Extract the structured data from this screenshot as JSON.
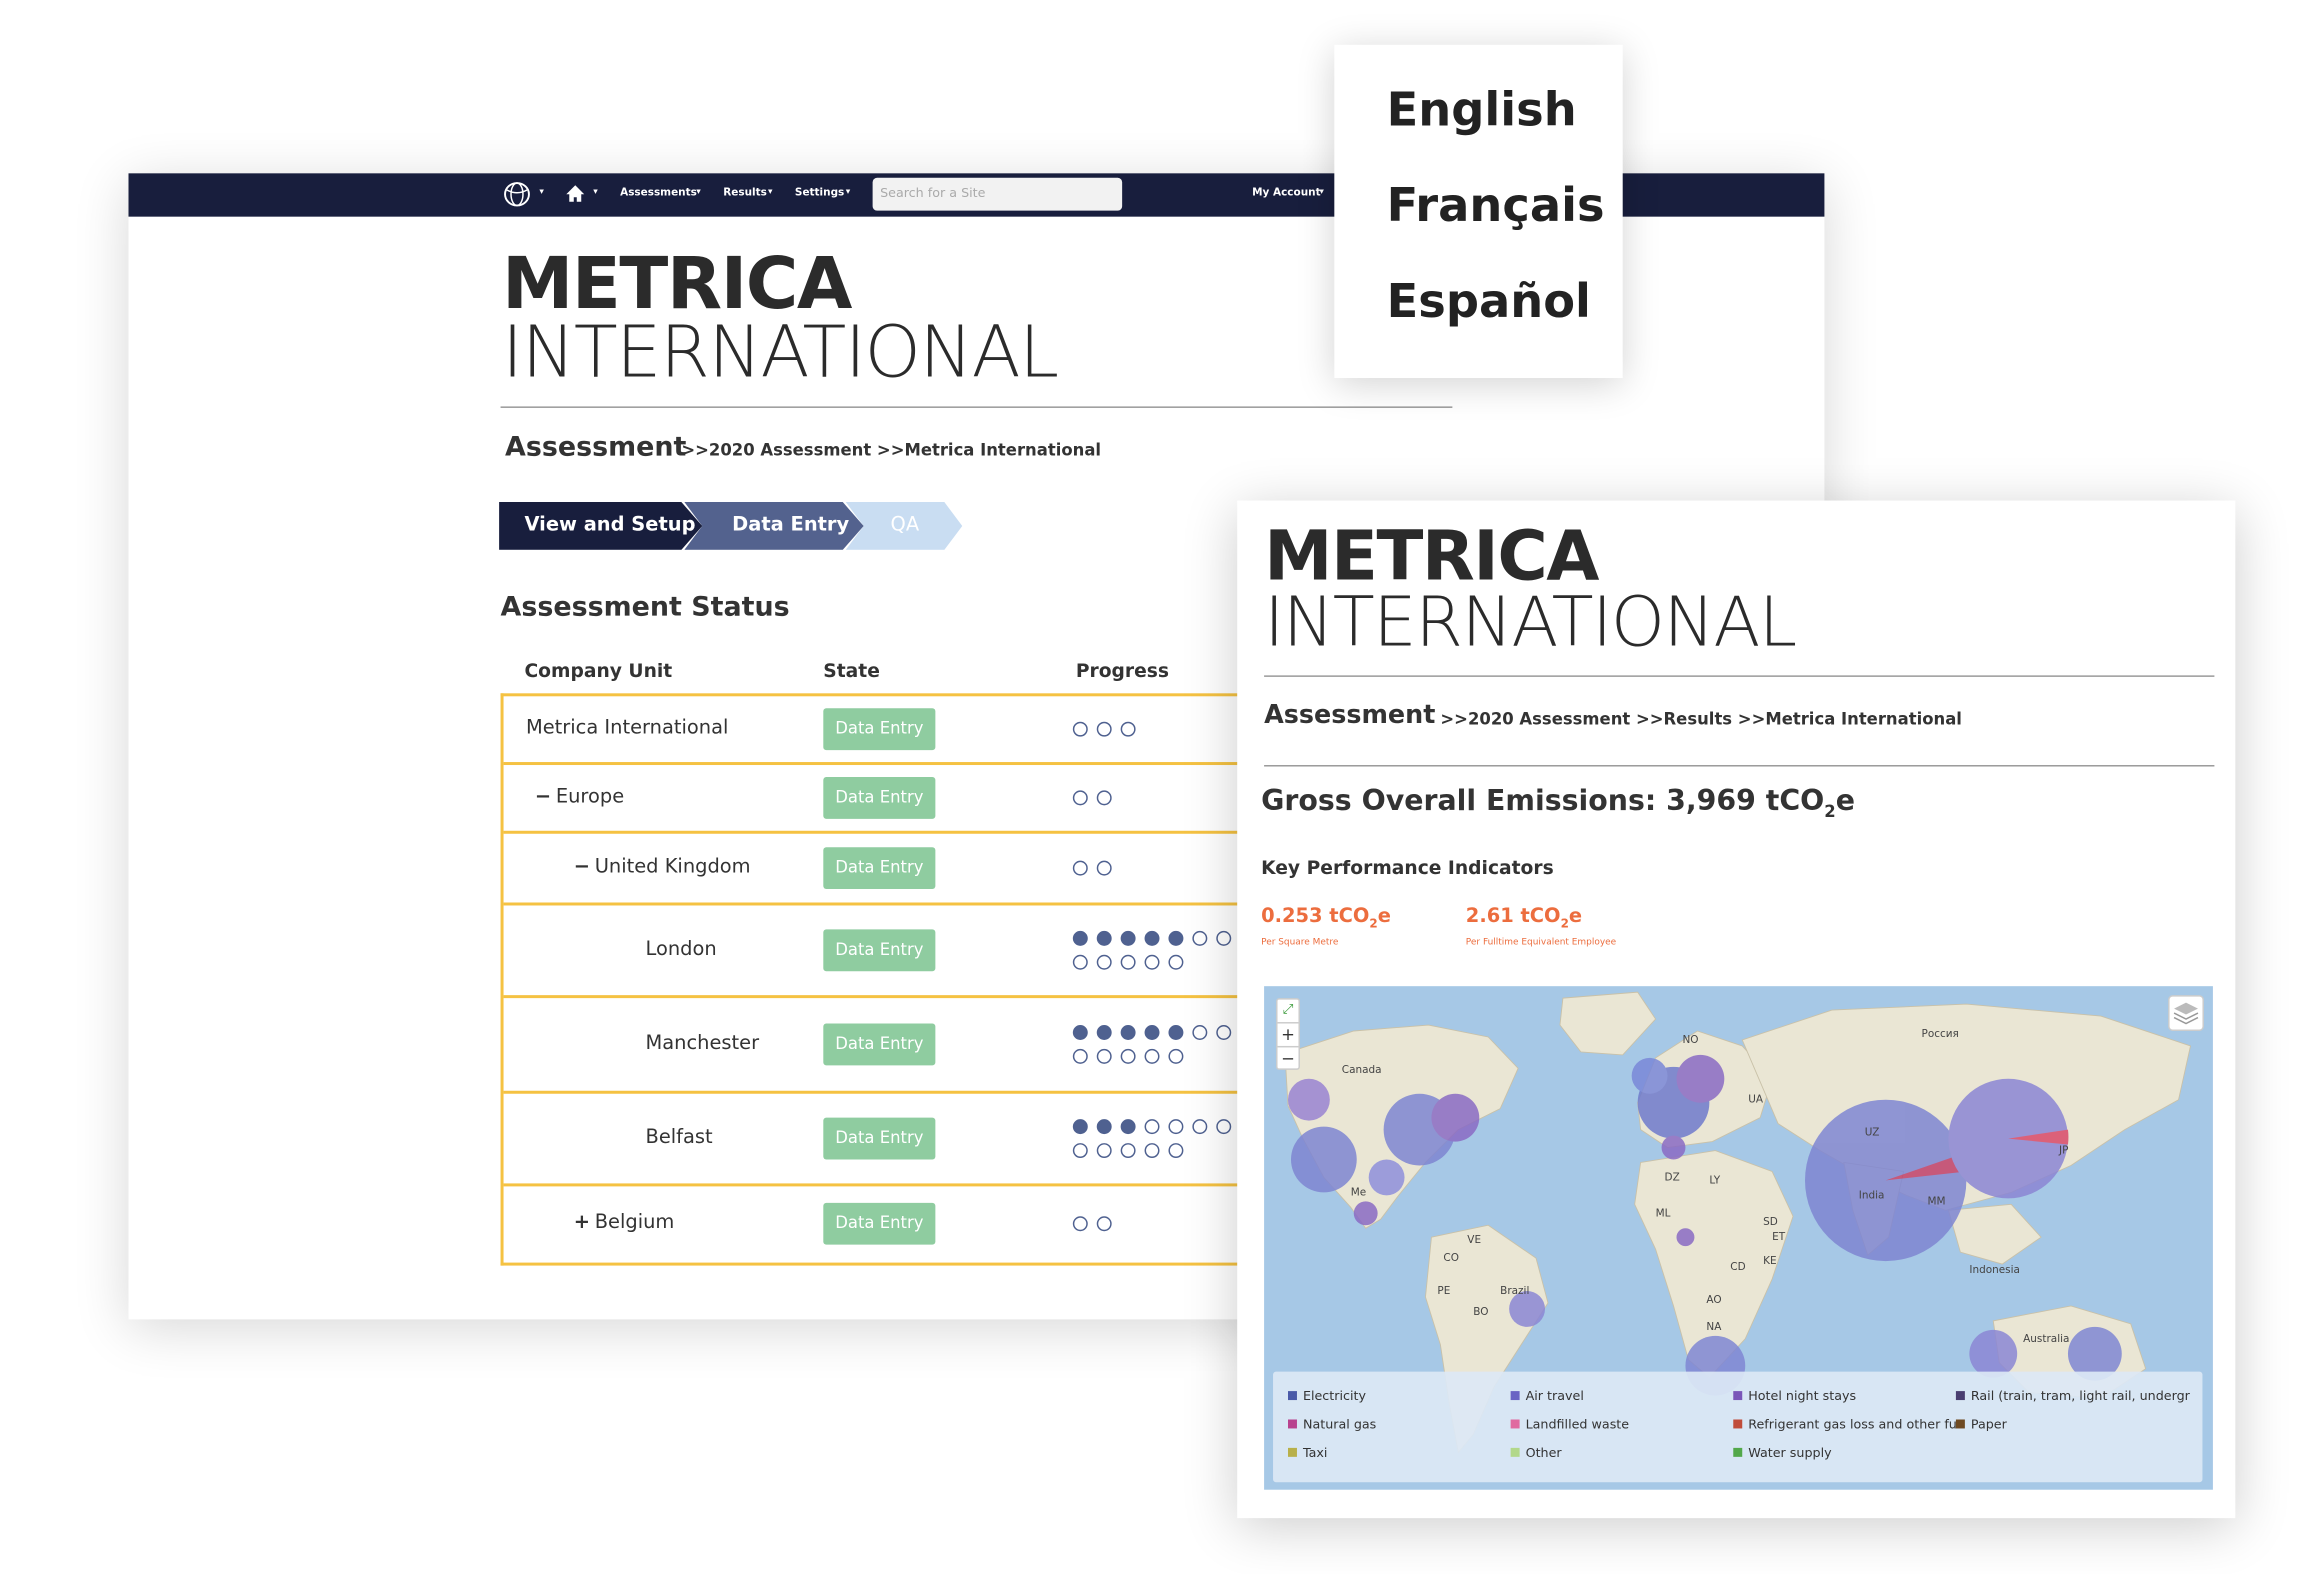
{
  "nav": {
    "menus": [
      "Assessments",
      "Results",
      "Settings"
    ],
    "search_placeholder": "Search for a Site",
    "account": "My Account",
    "caret": "▾"
  },
  "brand": {
    "bold": "METRICA",
    "light": "INTERNATIONAL"
  },
  "page1": {
    "crumb_heading": "Assessment",
    "crumb_path": ">>2020 Assessment >>Metrica International",
    "steps": [
      "View and Setup",
      "Data Entry",
      "QA"
    ],
    "status_title": "Assessment Status",
    "columns": [
      "Company Unit",
      "State",
      "Progress"
    ],
    "rows": [
      {
        "toggle": "",
        "unit": "Metrica International",
        "state": "Data Entry",
        "progress": {
          "done": 0,
          "total": 3
        }
      },
      {
        "toggle": "−",
        "unit": "Europe",
        "state": "Data Entry",
        "progress": {
          "done": 0,
          "total": 2
        }
      },
      {
        "toggle": "−",
        "unit": "United Kingdom",
        "state": "Data Entry",
        "progress": {
          "done": 0,
          "total": 2
        }
      },
      {
        "toggle": "",
        "unit": "London",
        "state": "Data Entry",
        "progress": {
          "done": 5,
          "total": 12
        }
      },
      {
        "toggle": "",
        "unit": "Manchester",
        "state": "Data Entry",
        "progress": {
          "done": 5,
          "total": 12
        }
      },
      {
        "toggle": "",
        "unit": "Belfast",
        "state": "Data Entry",
        "progress": {
          "done": 3,
          "total": 12
        }
      },
      {
        "toggle": "+",
        "unit": "Belgium",
        "state": "Data Entry",
        "progress": {
          "done": 0,
          "total": 2
        }
      }
    ]
  },
  "languages": [
    "English",
    "Français",
    "Español"
  ],
  "page2": {
    "crumb_heading": "Assessment",
    "crumb_path": ">>2020 Assessment >>Results >>Metrica International",
    "gross_label": "Gross Overall Emissions: 3,969 tCO",
    "gross_sub": "2",
    "gross_suffix": "e",
    "kpi_title": "Key Performance Indicators",
    "kpis": [
      {
        "value": "0.253 tCO",
        "sub": "2",
        "suffix": "e",
        "caption": "Per Square Metre"
      },
      {
        "value": "2.61 tCO",
        "sub": "2",
        "suffix": "e",
        "caption": "Per Fulltime Equivalent Employee"
      }
    ],
    "map_labels": [
      "Canada",
      "Россия",
      "India",
      "Indonesia",
      "Australia",
      "NO",
      "UA",
      "DZ",
      "LY",
      "SD",
      "ML",
      "ET",
      "CD",
      "KE",
      "AO",
      "NA",
      "VE",
      "CO",
      "PE",
      "BO",
      "Brazil",
      "Me",
      "UZ",
      "JP",
      "MM"
    ],
    "map_controls": {
      "zoom_in": "+",
      "zoom_out": "−"
    },
    "legend": [
      {
        "label": "Electricity",
        "color": "#4a5aa8"
      },
      {
        "label": "Air travel",
        "color": "#6a64c4"
      },
      {
        "label": "Hotel night stays",
        "color": "#7a56b8"
      },
      {
        "label": "Rail (train, tram, light rail, undergr",
        "color": "#4a3e70"
      },
      {
        "label": "Natural gas",
        "color": "#b8428e"
      },
      {
        "label": "Landfilled waste",
        "color": "#e06aa0"
      },
      {
        "label": "Refrigerant gas loss and other fu",
        "color": "#c04c3a"
      },
      {
        "label": "Paper",
        "color": "#6e4a22"
      },
      {
        "label": "Taxi",
        "color": "#b8b04a"
      },
      {
        "label": "Other",
        "color": "#b2d88a"
      },
      {
        "label": "Water supply",
        "color": "#52a84a"
      }
    ]
  }
}
